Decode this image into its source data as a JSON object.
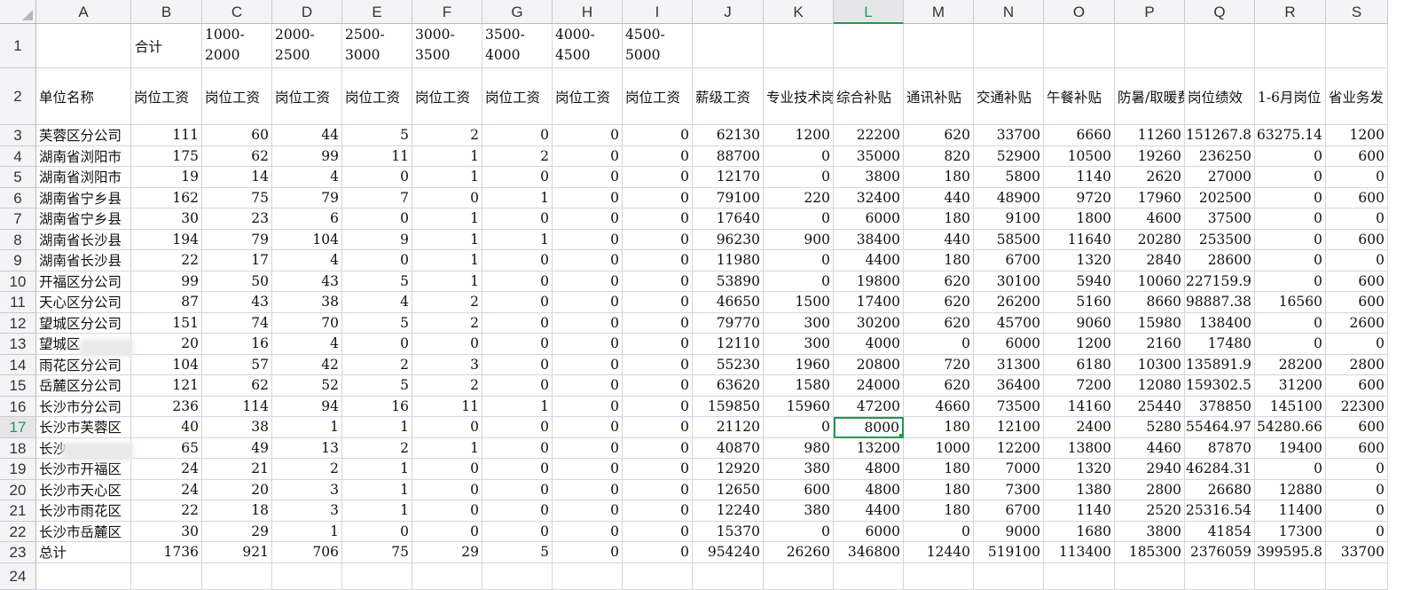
{
  "sheet": {
    "columns": [
      "A",
      "B",
      "C",
      "D",
      "E",
      "F",
      "G",
      "H",
      "I",
      "J",
      "K",
      "L",
      "M",
      "N",
      "O",
      "P",
      "Q",
      "R",
      "S"
    ],
    "selected_column": "L",
    "selected_row": "17",
    "header_row1": [
      "",
      "合计",
      "1000-2000",
      "2000-2500",
      "2500-3000",
      "3000-3500",
      "3500-4000",
      "4000-4500",
      "4500-5000",
      "",
      "",
      "",
      "",
      "",
      "",
      "",
      "",
      "",
      ""
    ],
    "header_row2": [
      "单位名称",
      "岗位工资",
      "岗位工资",
      "岗位工资",
      "岗位工资",
      "岗位工资",
      "岗位工资",
      "岗位工资",
      "岗位工资",
      "薪级工资",
      "专业技术岗位津贴",
      "综合补贴",
      "通讯补贴",
      "交通补贴",
      "午餐补贴",
      "防暑/取暖费",
      "岗位绩效",
      "1-6月岗位",
      "省业务发"
    ],
    "rows": [
      {
        "n": "3",
        "c": [
          "芙蓉区分公司",
          "111",
          "60",
          "44",
          "5",
          "2",
          "0",
          "0",
          "0",
          "62130",
          "1200",
          "22200",
          "620",
          "33700",
          "6660",
          "11260",
          "151267.8",
          "63275.14",
          "1200"
        ]
      },
      {
        "n": "4",
        "c": [
          "湖南省浏阳市",
          "175",
          "62",
          "99",
          "11",
          "1",
          "2",
          "0",
          "0",
          "88700",
          "0",
          "35000",
          "820",
          "52900",
          "10500",
          "19260",
          "236250",
          "0",
          "600"
        ]
      },
      {
        "n": "5",
        "c": [
          "湖南省浏阳市",
          "19",
          "14",
          "4",
          "0",
          "1",
          "0",
          "0",
          "0",
          "12170",
          "0",
          "3800",
          "180",
          "5800",
          "1140",
          "2620",
          "27000",
          "0",
          "0"
        ]
      },
      {
        "n": "6",
        "c": [
          "湖南省宁乡县",
          "162",
          "75",
          "79",
          "7",
          "0",
          "1",
          "0",
          "0",
          "79100",
          "220",
          "32400",
          "440",
          "48900",
          "9720",
          "17960",
          "202500",
          "0",
          "600"
        ]
      },
      {
        "n": "7",
        "c": [
          "湖南省宁乡县",
          "30",
          "23",
          "6",
          "0",
          "1",
          "0",
          "0",
          "0",
          "17640",
          "0",
          "6000",
          "180",
          "9100",
          "1800",
          "4600",
          "37500",
          "0",
          "0"
        ]
      },
      {
        "n": "8",
        "c": [
          "湖南省长沙县",
          "194",
          "79",
          "104",
          "9",
          "1",
          "1",
          "0",
          "0",
          "96230",
          "900",
          "38400",
          "440",
          "58500",
          "11640",
          "20280",
          "253500",
          "0",
          "600"
        ]
      },
      {
        "n": "9",
        "c": [
          "湖南省长沙县",
          "22",
          "17",
          "4",
          "0",
          "1",
          "0",
          "0",
          "0",
          "11980",
          "0",
          "4400",
          "180",
          "6700",
          "1320",
          "2840",
          "28600",
          "0",
          "0"
        ]
      },
      {
        "n": "10",
        "c": [
          "开福区分公司",
          "99",
          "50",
          "43",
          "5",
          "1",
          "0",
          "0",
          "0",
          "53890",
          "0",
          "19800",
          "620",
          "30100",
          "5940",
          "10060",
          "227159.9",
          "0",
          "600"
        ]
      },
      {
        "n": "11",
        "c": [
          "天心区分公司",
          "87",
          "43",
          "38",
          "4",
          "2",
          "0",
          "0",
          "0",
          "46650",
          "1500",
          "17400",
          "620",
          "26200",
          "5160",
          "8660",
          "98887.38",
          "16560",
          "600"
        ]
      },
      {
        "n": "12",
        "c": [
          "望城区分公司",
          "151",
          "74",
          "70",
          "5",
          "2",
          "0",
          "0",
          "0",
          "79770",
          "300",
          "30200",
          "620",
          "45700",
          "9060",
          "15980",
          "138400",
          "0",
          "2600"
        ]
      },
      {
        "n": "13",
        "c": [
          "望城区",
          "20",
          "16",
          "4",
          "0",
          "0",
          "0",
          "0",
          "0",
          "12110",
          "300",
          "4000",
          "0",
          "6000",
          "1200",
          "2160",
          "17480",
          "0",
          "0"
        ]
      },
      {
        "n": "14",
        "c": [
          "雨花区分公司",
          "104",
          "57",
          "42",
          "2",
          "3",
          "0",
          "0",
          "0",
          "55230",
          "1960",
          "20800",
          "720",
          "31300",
          "6180",
          "10300",
          "135891.9",
          "28200",
          "2800"
        ]
      },
      {
        "n": "15",
        "c": [
          "岳麓区分公司",
          "121",
          "62",
          "52",
          "5",
          "2",
          "0",
          "0",
          "0",
          "63620",
          "1580",
          "24000",
          "620",
          "36400",
          "7200",
          "12080",
          "159302.5",
          "31200",
          "600"
        ]
      },
      {
        "n": "16",
        "c": [
          "长沙市分公司",
          "236",
          "114",
          "94",
          "16",
          "11",
          "1",
          "0",
          "0",
          "159850",
          "15960",
          "47200",
          "4660",
          "73500",
          "14160",
          "25440",
          "378850",
          "145100",
          "22300"
        ]
      },
      {
        "n": "17",
        "c": [
          "长沙市芙蓉区",
          "40",
          "38",
          "1",
          "1",
          "0",
          "0",
          "0",
          "0",
          "21120",
          "0",
          "8000",
          "180",
          "12100",
          "2400",
          "5280",
          "55464.97",
          "54280.66",
          "600"
        ]
      },
      {
        "n": "18",
        "c": [
          "长沙",
          "65",
          "49",
          "13",
          "2",
          "1",
          "0",
          "0",
          "0",
          "40870",
          "980",
          "13200",
          "1000",
          "12200",
          "13800",
          "4460",
          "87870",
          "19400",
          "600"
        ]
      },
      {
        "n": "19",
        "c": [
          "长沙市开福区",
          "24",
          "21",
          "2",
          "1",
          "0",
          "0",
          "0",
          "0",
          "12920",
          "380",
          "4800",
          "180",
          "7000",
          "1320",
          "2940",
          "46284.31",
          "0",
          "0"
        ]
      },
      {
        "n": "20",
        "c": [
          "长沙市天心区",
          "24",
          "20",
          "3",
          "1",
          "0",
          "0",
          "0",
          "0",
          "12650",
          "600",
          "4800",
          "180",
          "7300",
          "1380",
          "2800",
          "26680",
          "12880",
          "0"
        ]
      },
      {
        "n": "21",
        "c": [
          "长沙市雨花区",
          "22",
          "18",
          "3",
          "1",
          "0",
          "0",
          "0",
          "0",
          "12240",
          "380",
          "4400",
          "180",
          "6700",
          "1140",
          "2520",
          "25316.54",
          "11400",
          "0"
        ]
      },
      {
        "n": "22",
        "c": [
          "长沙市岳麓区",
          "30",
          "29",
          "1",
          "0",
          "0",
          "0",
          "0",
          "0",
          "15370",
          "0",
          "6000",
          "0",
          "9000",
          "1680",
          "3800",
          "41854",
          "17300",
          "0"
        ]
      },
      {
        "n": "23",
        "c": [
          "总计",
          "1736",
          "921",
          "706",
          "75",
          "29",
          "5",
          "0",
          "0",
          "954240",
          "26260",
          "346800",
          "12440",
          "519100",
          "113400",
          "185300",
          "2376059",
          "399595.8",
          "33700"
        ]
      }
    ],
    "row_numbers": [
      "1",
      "2",
      "24"
    ]
  }
}
